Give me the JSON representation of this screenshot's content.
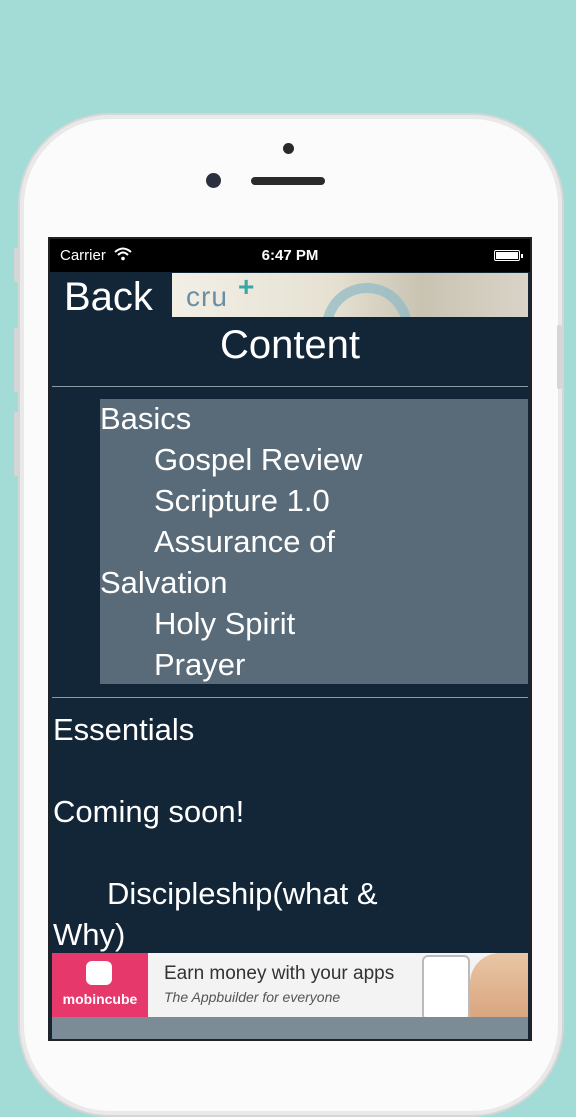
{
  "status_bar": {
    "carrier": "Carrier",
    "wifi_icon": "wifi-icon",
    "time": "6:47 PM",
    "battery_icon": "battery-icon"
  },
  "header": {
    "back_label": "Back",
    "logo_text": "cru",
    "title": "Content"
  },
  "basics": {
    "heading": "Basics",
    "items": [
      "Gospel Review",
      "Scripture 1.0",
      "Assurance of",
      "Salvation",
      "Holy Spirit",
      "Prayer"
    ]
  },
  "essentials": {
    "heading": "Essentials",
    "note": "Coming soon!",
    "item_line1": "Discipleship(what &",
    "item_line2": "Why)"
  },
  "ad": {
    "brand": "mobincube",
    "headline": "Earn money with your apps",
    "tagline": "The Appbuilder for everyone"
  },
  "colors": {
    "background": "#a3dcd6",
    "screen": "#132638",
    "basics_panel": "#596b78",
    "ad_brand": "#e6386b"
  }
}
